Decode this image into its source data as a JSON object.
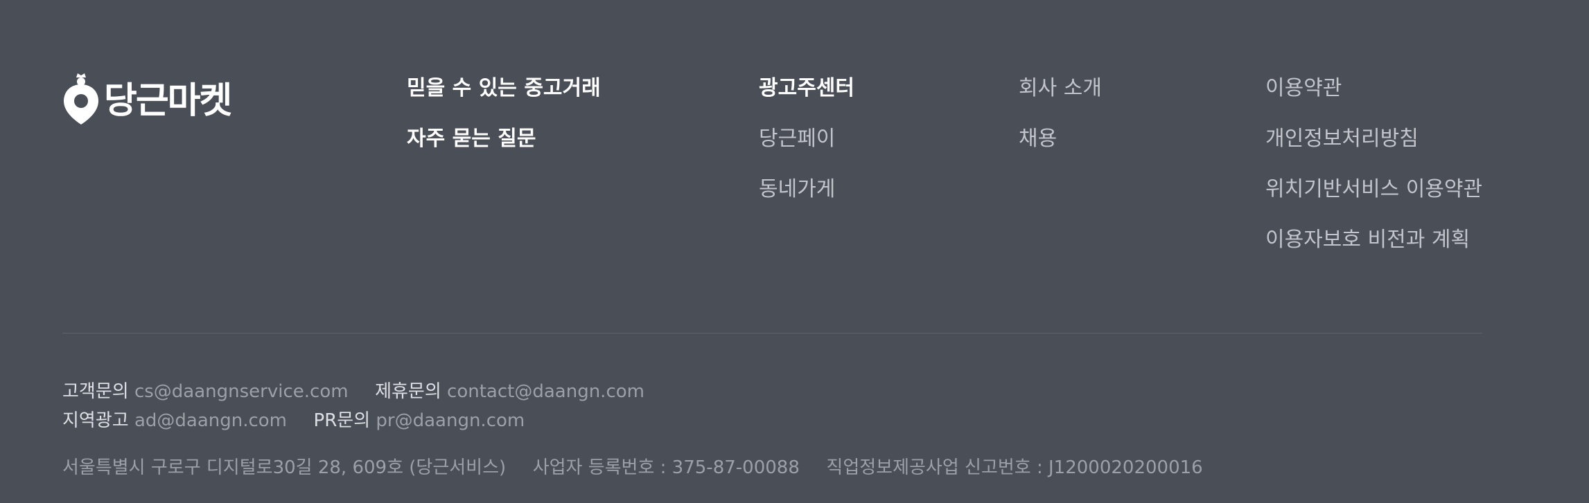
{
  "brand": {
    "name": "당근마켓",
    "icon": "carrot-icon",
    "colors": {
      "background": "#4a4e56",
      "bold_link": "#ffffff",
      "plain_link": "#c2c5cb",
      "muted": "#9ca1a8"
    }
  },
  "columns": [
    {
      "items": [
        {
          "label": "믿을 수 있는 중고거래",
          "bold": true
        },
        {
          "label": "자주 묻는 질문",
          "bold": true
        }
      ]
    },
    {
      "items": [
        {
          "label": "광고주센터",
          "bold": true
        },
        {
          "label": "당근페이",
          "bold": false
        },
        {
          "label": "동네가게",
          "bold": false
        }
      ]
    },
    {
      "items": [
        {
          "label": "회사 소개",
          "bold": false
        },
        {
          "label": "채용",
          "bold": false
        }
      ]
    },
    {
      "items": [
        {
          "label": "이용약관",
          "bold": false
        },
        {
          "label": "개인정보처리방침",
          "bold": false
        },
        {
          "label": "위치기반서비스 이용약관",
          "bold": false
        },
        {
          "label": "이용자보호 비전과 계획",
          "bold": false
        }
      ]
    }
  ],
  "contacts": {
    "customer": {
      "label": "고객문의",
      "email": "cs@daangnservice.com"
    },
    "partnership": {
      "label": "제휴문의",
      "email": "contact@daangn.com"
    },
    "local_ads": {
      "label": "지역광고",
      "email": "ad@daangn.com"
    },
    "pr": {
      "label": "PR문의",
      "email": "pr@daangn.com"
    }
  },
  "company": {
    "address": "서울특별시 구로구 디지털로30길 28, 609호 (당근서비스)",
    "business_registration": "사업자 등록번호 : 375-87-00088",
    "job_info_registration": "직업정보제공사업 신고번호 : J1200020200016"
  }
}
